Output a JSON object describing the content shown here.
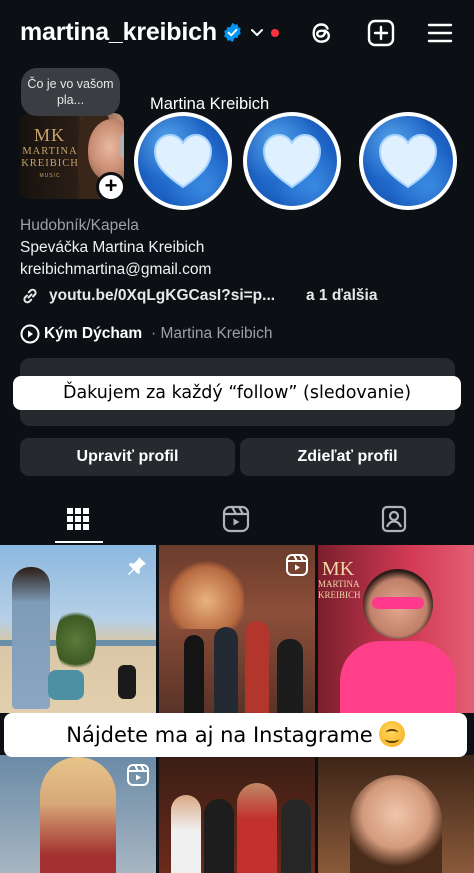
{
  "header": {
    "username": "martina_kreibich",
    "icons": [
      "verified-badge-icon",
      "chevron-down-icon",
      "notification-dot",
      "threads-icon",
      "add-post-icon",
      "menu-icon"
    ],
    "accent": "#0095f6",
    "notification_color": "#ff3040"
  },
  "story": {
    "note": "Čo je vo vašom pla...",
    "name": "Martina Kreibich",
    "avatar_logo": "MK",
    "avatar_text": "MARTINA KREIBICH",
    "avatar_music": "MUSIC"
  },
  "highlights": [
    {
      "icon": "heart-icon"
    },
    {
      "icon": "heart-icon"
    },
    {
      "icon": "heart-icon"
    }
  ],
  "bio": {
    "category": "Hudobník/Kapela",
    "line1": "Speváčka Martina Kreibich",
    "email": "kreibichmartina@gmail.com",
    "link": "youtu.be/0XqLgKGCasI?si=p...",
    "link_more": "a 1 ďalšia",
    "song": "Kým Dýcham",
    "song_artist": "· Martina Kreibich"
  },
  "captions": {
    "top": "Ďakujem za každý “follow” (sledovanie)",
    "bottom": "Nájdete ma aj na Instagrame"
  },
  "buttons": {
    "edit": "Upraviť profil",
    "share": "Zdieľať profil"
  },
  "tabs": [
    {
      "icon": "grid-icon",
      "active": true
    },
    {
      "icon": "reels-icon",
      "active": false
    },
    {
      "icon": "tagged-icon",
      "active": false
    }
  ],
  "grid": {
    "watermark_logo": "MK",
    "watermark_text": "MARTINA KREIBICH",
    "posts": [
      {
        "type": "pinned"
      },
      {
        "type": "reel"
      },
      {
        "type": "photo"
      },
      {
        "type": "reel"
      },
      {
        "type": "photo"
      },
      {
        "type": "photo"
      }
    ]
  }
}
